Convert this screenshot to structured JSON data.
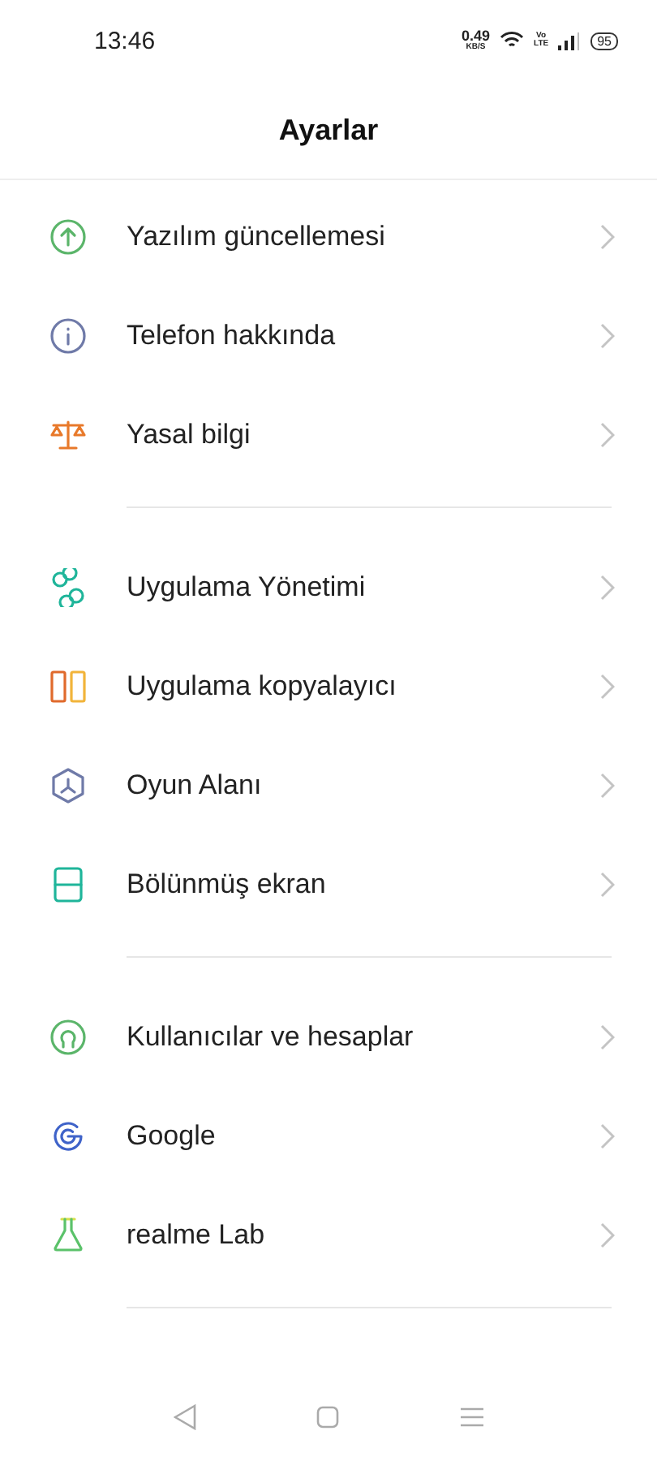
{
  "status_bar": {
    "time": "13:46",
    "speed": "0.49",
    "speed_unit": "KB/S",
    "volte_top": "Vo",
    "volte_bottom": "LTE",
    "battery": "95"
  },
  "title": "Ayarlar",
  "groups": [
    {
      "items": [
        {
          "label": "Yazılım güncellemesi"
        },
        {
          "label": "Telefon hakkında"
        },
        {
          "label": "Yasal bilgi"
        }
      ]
    },
    {
      "items": [
        {
          "label": "Uygulama Yönetimi"
        },
        {
          "label": "Uygulama kopyalayıcı"
        },
        {
          "label": "Oyun Alanı"
        },
        {
          "label": "Bölünmüş ekran"
        }
      ]
    },
    {
      "items": [
        {
          "label": "Kullanıcılar ve hesaplar"
        },
        {
          "label": "Google"
        },
        {
          "label": "realme Lab"
        }
      ]
    }
  ]
}
